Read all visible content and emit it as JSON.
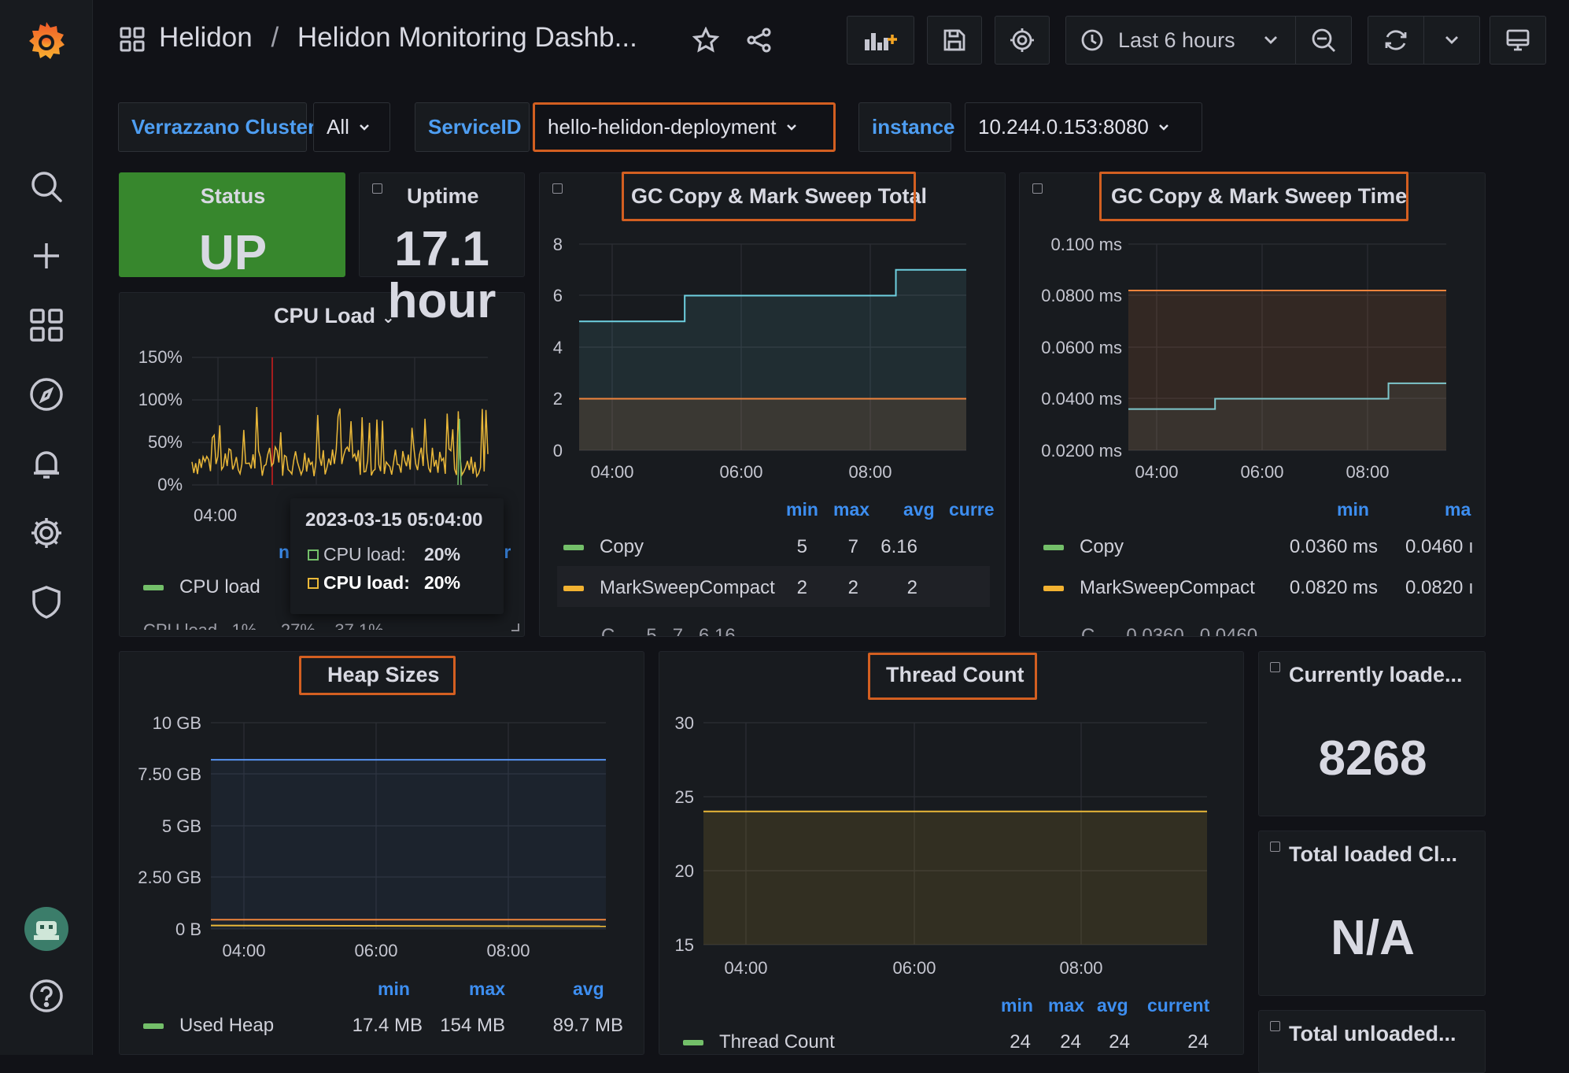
{
  "header": {
    "folder": "Helidon",
    "sep": "/",
    "title": "Helidon Monitoring Dashb...",
    "time_range": "Last 6 hours"
  },
  "variables": [
    {
      "label": "Verrazzano Cluster",
      "value": "All"
    },
    {
      "label": "ServiceID",
      "value": "hello-helidon-deployment"
    },
    {
      "label": "instance",
      "value": "10.244.0.153:8080"
    }
  ],
  "status": {
    "title": "Status",
    "value": "UP",
    "color": "#37872d"
  },
  "uptime": {
    "title": "Uptime",
    "value": "17.1",
    "unit": "hour"
  },
  "cpu": {
    "title": "CPU Load",
    "y_ticks": [
      "150%",
      "100%",
      "50%",
      "0%"
    ],
    "x_ticks": [
      "04:00"
    ],
    "legend_series": "CPU load",
    "legend_hint_left": "n",
    "legend_hint_right": "ır",
    "cut_row": "CPU load   1%     27%    37.1%",
    "tooltip": {
      "time": "2023-03-15 05:04:00",
      "rows": [
        {
          "label": "CPU load:",
          "value": "20%"
        },
        {
          "label": "CPU load:",
          "value": "20%"
        }
      ]
    },
    "color": "#eab839"
  },
  "gc_total": {
    "title": "GC Copy & Mark Sweep Total",
    "y_ticks": [
      "8",
      "6",
      "4",
      "2",
      "0"
    ],
    "x_ticks": [
      "04:00",
      "06:00",
      "08:00"
    ],
    "headers": [
      "min",
      "max",
      "avg",
      "curre"
    ],
    "rows": [
      {
        "name": "Copy",
        "color": "#73bf69",
        "min": "5",
        "max": "7",
        "avg": "6.16"
      },
      {
        "name": "MarkSweepCompact",
        "color": "#f2b231",
        "min": "2",
        "max": "2",
        "avg": "2"
      }
    ],
    "cut_row": "C...   5   7   6.16"
  },
  "gc_time": {
    "title": "GC Copy & Mark Sweep Time",
    "y_ticks": [
      "0.100 ms",
      "0.0800 ms",
      "0.0600 ms",
      "0.0400 ms",
      "0.0200 ms"
    ],
    "x_ticks": [
      "04:00",
      "06:00",
      "08:00"
    ],
    "headers": [
      "min",
      "ma"
    ],
    "rows": [
      {
        "name": "Copy",
        "color": "#73bf69",
        "min": "0.0360 ms",
        "max": "0.0460 ı"
      },
      {
        "name": "MarkSweepCompact",
        "color": "#f2b231",
        "min": "0.0820 ms",
        "max": "0.0820 ı"
      }
    ],
    "cut_row": "C...   0.0360   0.0460"
  },
  "heap": {
    "title": "Heap Sizes",
    "y_ticks": [
      "10 GB",
      "7.50 GB",
      "5 GB",
      "2.50 GB",
      "0 B"
    ],
    "x_ticks": [
      "04:00",
      "06:00",
      "08:00"
    ],
    "headers": [
      "min",
      "max",
      "avg"
    ],
    "rows": [
      {
        "name": "Used Heap",
        "color": "#73bf69",
        "min": "17.4 MB",
        "max": "154 MB",
        "avg": "89.7 MB"
      }
    ]
  },
  "threads": {
    "title": "Thread Count",
    "y_ticks": [
      "30",
      "25",
      "20",
      "15"
    ],
    "x_ticks": [
      "04:00",
      "06:00",
      "08:00"
    ],
    "headers": [
      "min",
      "max",
      "avg",
      "current"
    ],
    "rows": [
      {
        "name": "Thread Count",
        "color": "#73bf69",
        "min": "24",
        "max": "24",
        "avg": "24",
        "current": "24"
      }
    ]
  },
  "classes_loaded": {
    "title": "Currently loade...",
    "value": "8268"
  },
  "classes_total": {
    "title": "Total loaded Cl...",
    "value": "N/A"
  },
  "classes_unloaded": {
    "title": "Total unloaded..."
  },
  "chart_data": [
    {
      "type": "line",
      "title": "CPU Load",
      "ylabel": "",
      "ylim": [
        0,
        150
      ],
      "x": [
        "03:30",
        "04:00",
        "05:00",
        "06:00",
        "07:00",
        "08:00",
        "09:00"
      ],
      "series": [
        {
          "name": "CPU load",
          "values": [
            10,
            40,
            60,
            35,
            30,
            40,
            20
          ]
        }
      ]
    },
    {
      "type": "area",
      "title": "GC Copy & Mark Sweep Total",
      "ylim": [
        0,
        8
      ],
      "x": [
        "03:30",
        "04:00",
        "05:00",
        "06:00",
        "07:00",
        "08:00",
        "09:00"
      ],
      "series": [
        {
          "name": "Copy",
          "values": [
            5,
            5,
            6,
            6,
            6,
            7,
            7
          ]
        },
        {
          "name": "MarkSweepCompact",
          "values": [
            2,
            2,
            2,
            2,
            2,
            2,
            2
          ]
        }
      ]
    },
    {
      "type": "area",
      "title": "GC Copy & Mark Sweep Time",
      "ylim": [
        0.02,
        0.1
      ],
      "x": [
        "03:30",
        "04:00",
        "05:00",
        "06:00",
        "07:00",
        "08:00",
        "09:00"
      ],
      "series": [
        {
          "name": "Copy",
          "values": [
            0.036,
            0.036,
            0.04,
            0.04,
            0.04,
            0.046,
            0.046
          ]
        },
        {
          "name": "MarkSweepCompact",
          "values": [
            0.082,
            0.082,
            0.082,
            0.082,
            0.082,
            0.082,
            0.082
          ]
        }
      ]
    },
    {
      "type": "area",
      "title": "Heap Sizes",
      "ylim": [
        0,
        10
      ],
      "x": [
        "03:30",
        "04:00",
        "05:00",
        "06:00",
        "07:00",
        "08:00",
        "09:00"
      ],
      "series": [
        {
          "name": "Used Heap",
          "values": [
            0.09,
            0.09,
            0.09,
            0.09,
            0.09,
            0.09,
            0.09
          ]
        }
      ]
    },
    {
      "type": "area",
      "title": "Thread Count",
      "ylim": [
        15,
        30
      ],
      "x": [
        "03:30",
        "04:00",
        "05:00",
        "06:00",
        "07:00",
        "08:00",
        "09:00"
      ],
      "series": [
        {
          "name": "Thread Count",
          "values": [
            24,
            24,
            24,
            24,
            24,
            24,
            24
          ]
        }
      ]
    }
  ]
}
